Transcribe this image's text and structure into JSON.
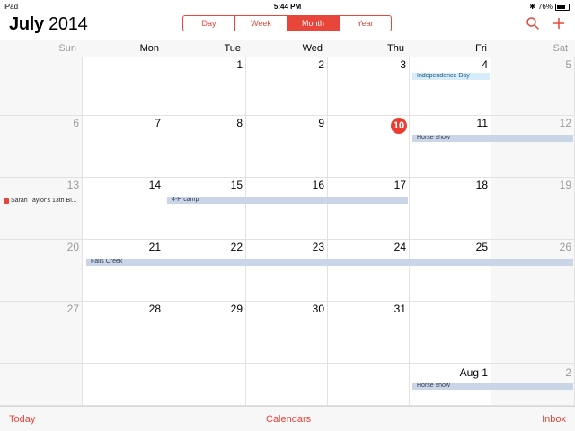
{
  "status_bar": {
    "device": "iPad",
    "time": "5:44 PM",
    "battery_percent": "76%",
    "battery_level": 0.76
  },
  "header": {
    "month": "July",
    "year": "2014",
    "views": [
      "Day",
      "Week",
      "Month",
      "Year"
    ],
    "active_view": "Month"
  },
  "weekdays": [
    "Sun",
    "Mon",
    "Tue",
    "Wed",
    "Thu",
    "Fri",
    "Sat"
  ],
  "weeks": [
    [
      "",
      "",
      "1",
      "2",
      "3",
      "4",
      "5"
    ],
    [
      "6",
      "7",
      "8",
      "9",
      "10",
      "11",
      "12"
    ],
    [
      "13",
      "14",
      "15",
      "16",
      "17",
      "18",
      "19"
    ],
    [
      "20",
      "21",
      "22",
      "23",
      "24",
      "25",
      "26"
    ],
    [
      "27",
      "28",
      "29",
      "30",
      "31",
      "",
      ""
    ],
    [
      "",
      "",
      "",
      "",
      "",
      "Aug 1",
      "2"
    ]
  ],
  "today": "10",
  "events": {
    "independence_day": "Independence Day",
    "horse_show_1": "Horse show",
    "birthday": "Sarah Taylor's 13th Bi...",
    "four_h_camp": "4-H camp",
    "falls_creek": "Falls Creek",
    "horse_show_2": "Horse show"
  },
  "toolbar": {
    "today": "Today",
    "calendars": "Calendars",
    "inbox": "Inbox"
  },
  "colors": {
    "accent": "#e8463a",
    "today_red": "#ec3b2f",
    "event_gray": "#cbd5e8",
    "event_light_blue": "#d7ecfb"
  }
}
